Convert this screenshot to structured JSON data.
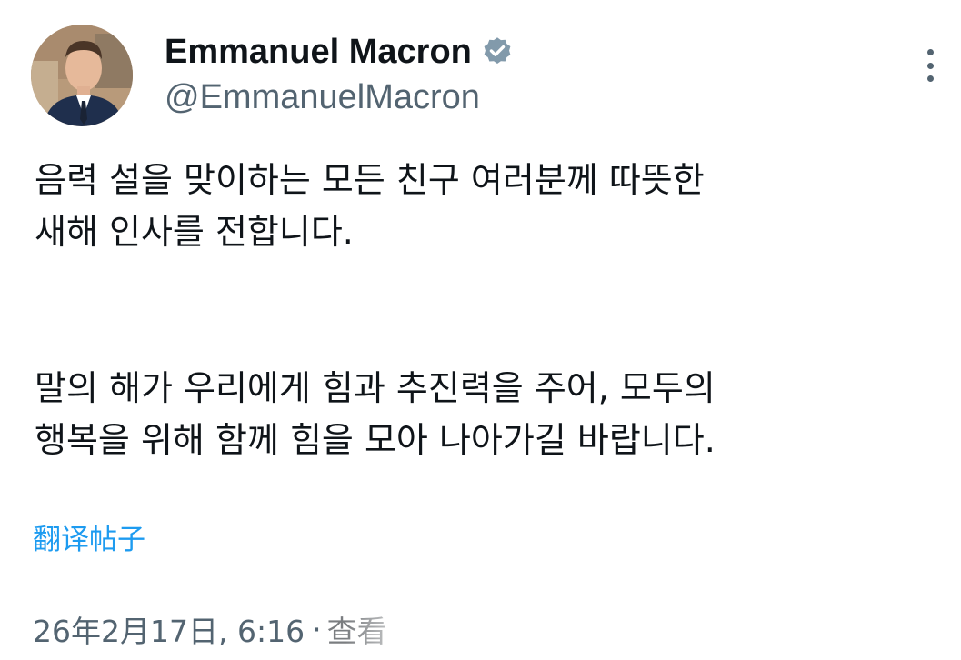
{
  "author": {
    "display_name": "Emmanuel Macron",
    "handle": "@EmmanuelMacron",
    "avatar_icon": "profile-photo",
    "verified_icon": "verified-badge-icon"
  },
  "tweet": {
    "paragraph_1_line_1": "음력 설을 맞이하는 모든 친구 여러분께 따뜻한",
    "paragraph_1_line_2": "새해 인사를 전합니다.",
    "paragraph_2_line_1": "말의 해가 우리에게 힘과 추진력을 주어, 모두의",
    "paragraph_2_line_2": "행복을 위해 함께 힘을 모아 나아가길 바랍니다."
  },
  "translate_label": "翻译帖子",
  "meta": {
    "timestamp": "26年2月17日, 6:16",
    "separator": "·",
    "views_partial": "查看"
  },
  "colors": {
    "text_primary": "#0f1419",
    "text_secondary": "#536471",
    "link": "#1d9bf0",
    "verified": "#829aab"
  }
}
